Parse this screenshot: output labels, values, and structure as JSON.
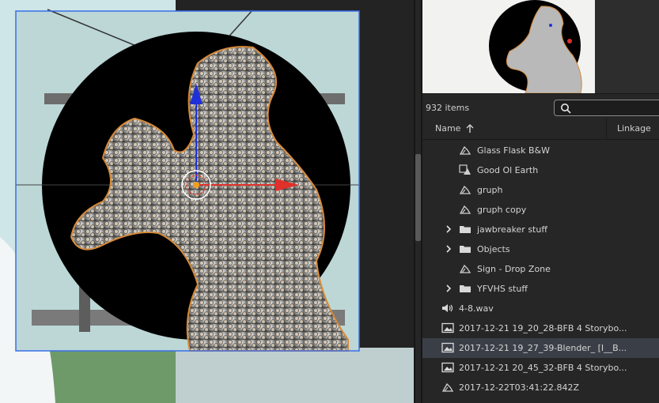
{
  "library": {
    "item_count": "932 items",
    "search": {
      "placeholder": ""
    },
    "columns": {
      "name": "Name",
      "linkage": "Linkage"
    },
    "items": [
      {
        "label": "Glass Flask B&W",
        "icon": "graphic-symbol-icon",
        "expandable": false,
        "level": 2,
        "selected": false
      },
      {
        "label": "Good Ol Earth",
        "icon": "bitmap-symbol-icon",
        "expandable": false,
        "level": 2,
        "selected": false
      },
      {
        "label": "gruph",
        "icon": "graphic-symbol-icon",
        "expandable": false,
        "level": 2,
        "selected": false
      },
      {
        "label": "gruph copy",
        "icon": "graphic-symbol-icon",
        "expandable": false,
        "level": 2,
        "selected": false
      },
      {
        "label": "jawbreaker stuff",
        "icon": "folder-icon",
        "expandable": true,
        "level": 1,
        "selected": false
      },
      {
        "label": "Objects",
        "icon": "folder-icon",
        "expandable": true,
        "level": 1,
        "selected": false
      },
      {
        "label": "Sign - Drop Zone",
        "icon": "graphic-symbol-icon",
        "expandable": false,
        "level": 2,
        "selected": false
      },
      {
        "label": "YFVHS stuff",
        "icon": "folder-icon",
        "expandable": true,
        "level": 1,
        "selected": false
      },
      {
        "label": "4-8.wav",
        "icon": "sound-icon",
        "expandable": false,
        "level": 0,
        "selected": false
      },
      {
        "label": "2017-12-21 19_20_28-BFB 4 Storybo...",
        "icon": "bitmap-icon",
        "expandable": false,
        "level": 0,
        "selected": false
      },
      {
        "label": "2017-12-21 19_27_39-Blender_ [I__B...",
        "icon": "bitmap-icon",
        "expandable": false,
        "level": 0,
        "selected": true
      },
      {
        "label": "2017-12-21 20_45_32-BFB 4 Storybo...",
        "icon": "bitmap-icon",
        "expandable": false,
        "level": 0,
        "selected": false
      },
      {
        "label": "2017-12-22T03:41:22.842Z",
        "icon": "graphic-symbol-icon",
        "expandable": false,
        "level": 0,
        "selected": false
      }
    ]
  },
  "colors": {
    "stage_bg": "#232323",
    "sky": "#cfe8ea",
    "grass": "#7fb07a",
    "selection_outline": "#3a6ee8",
    "axis_x": "#e0302a",
    "axis_y": "#2030d8",
    "panel_bg": "#262626",
    "row_selected": "#3a3f47"
  }
}
